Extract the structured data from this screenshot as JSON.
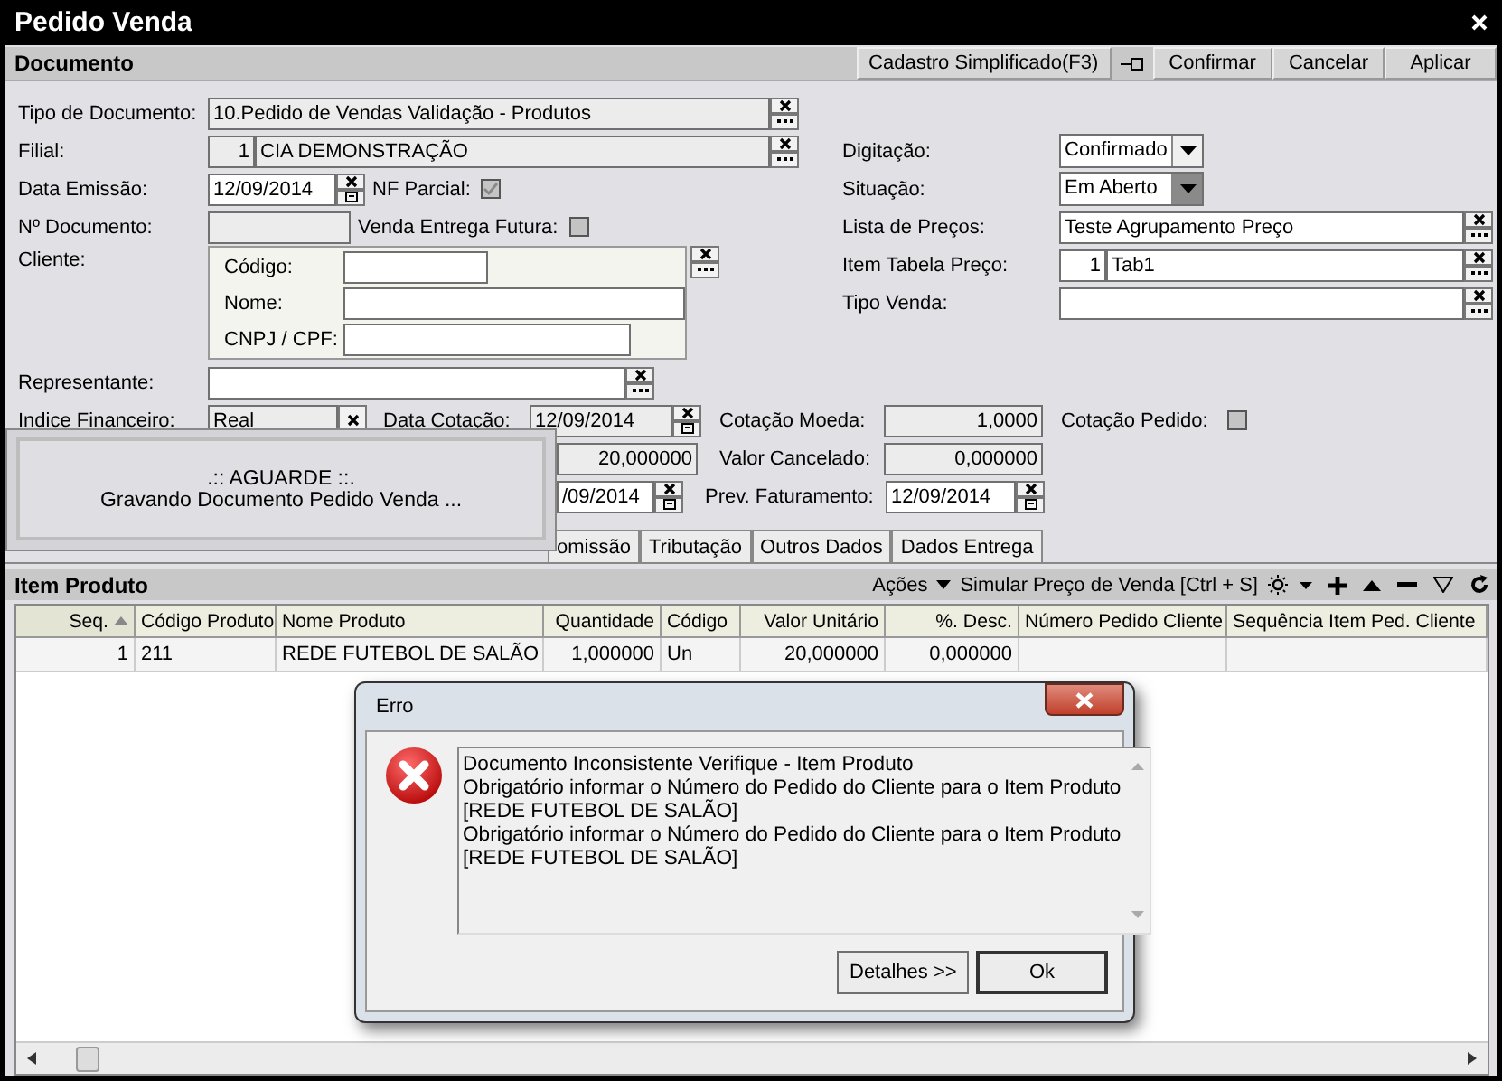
{
  "window": {
    "title": "Pedido Venda"
  },
  "header": {
    "title": "Documento",
    "buttons": [
      {
        "kind": "text",
        "label": "Cadastro Simplificado(F3)"
      },
      {
        "kind": "pin"
      },
      {
        "kind": "text",
        "label": "Confirmar"
      },
      {
        "kind": "text",
        "label": "Cancelar"
      },
      {
        "kind": "text",
        "label": "Aplicar"
      }
    ]
  },
  "left_fields": [
    {
      "kind": "lookup",
      "label": "Tipo de Documento:",
      "value": "10.Pedido de Vendas Validação - Produtos",
      "readonly": true
    },
    {
      "kind": "code_lookup",
      "label": "Filial:",
      "code": "1",
      "value": "CIA DEMONSTRAÇÃO",
      "readonly": true
    },
    {
      "kind": "date",
      "label": "Data Emissão:",
      "value": "12/09/2014",
      "check": {
        "label": "NF Parcial:",
        "checked": true,
        "disabled": true
      }
    },
    {
      "kind": "text",
      "label": "Nº Documento:",
      "readonly": true,
      "check": {
        "label": "Venda Entrega Futura:",
        "checked": false,
        "disabled": true
      }
    },
    {
      "kind": "client",
      "label": "Cliente:",
      "fields": [
        {
          "label": "Código:"
        },
        {
          "label": "Nome:"
        },
        {
          "label": "CNPJ / CPF:"
        }
      ]
    },
    {
      "kind": "lookup",
      "label": "Representante:",
      "readonly": false
    }
  ],
  "right_fields": [
    {
      "kind": "dropdown",
      "label": "Digitação:",
      "value": "Confirmado",
      "disabled": false
    },
    {
      "kind": "dropdown",
      "label": "Situação:",
      "value": "Em Aberto",
      "disabled": true
    },
    {
      "kind": "lookup",
      "label": "Lista de Preços:",
      "value": "Teste Agrupamento Preço",
      "readonly": false
    },
    {
      "kind": "code_lookup",
      "label": "Item Tabela Preço:",
      "code": "1",
      "value": "Tab1",
      "readonly": false
    },
    {
      "kind": "lookup",
      "label": "Tipo Venda:",
      "readonly": false
    }
  ],
  "values": {
    "indice": {
      "label": "Indice Financeiro:",
      "value": "Real",
      "readonly": true
    },
    "data_cotacao": {
      "label": "Data Cotação:",
      "value": "12/09/2014",
      "readonly": true
    },
    "cotacao_moeda": {
      "label": "Cotação Moeda:",
      "value": "1,0000",
      "readonly": true
    },
    "cotacao_pedido": {
      "label": "Cotação Pedido:",
      "checked": false,
      "disabled": true
    },
    "valor": {
      "value": "20,000000",
      "readonly": true
    },
    "valor_cancelado": {
      "label": "Valor Cancelado:",
      "value": "0,000000",
      "readonly": true
    },
    "data": {
      "value": "/09/2014",
      "readonly": false
    },
    "prev_faturamento": {
      "label": "Prev. Faturamento:",
      "value": "12/09/2014",
      "readonly": false
    }
  },
  "tabs": [
    {
      "label": "omissão",
      "selected": false
    },
    {
      "label": "Tributação",
      "selected": false
    },
    {
      "label": "Outros Dados",
      "selected": false
    },
    {
      "label": "Dados Entrega",
      "selected": false
    }
  ],
  "items_panel": {
    "title": "Item Produto",
    "actions": "Ações",
    "simulate": "Simular Preço de Venda [Ctrl + S]"
  },
  "table": {
    "columns": [
      {
        "label": "Seq.",
        "sorted": true
      },
      {
        "label": "Código Produto",
        "sorted": false
      },
      {
        "label": "Nome Produto",
        "sorted": false
      },
      {
        "label": "Quantidade",
        "sorted": false
      },
      {
        "label": "Código",
        "sorted": false
      },
      {
        "label": "Valor Unitário",
        "sorted": false
      },
      {
        "label": "%. Desc.",
        "sorted": false
      },
      {
        "label": "Número Pedido Cliente",
        "sorted": false
      },
      {
        "label": "Sequência Item Ped. Cliente",
        "sorted": false
      }
    ],
    "rows": [
      [
        "1",
        "211",
        "REDE FUTEBOL DE SALÃO",
        "1,000000",
        "Un",
        "20,000000",
        "0,000000"
      ]
    ]
  },
  "overlay": {
    "lines": [
      ".:: AGUARDE ::.",
      "Gravando Documento Pedido Venda ..."
    ]
  },
  "dialog": {
    "title": "Erro",
    "message": [
      "Documento Inconsistente Verifique - Item Produto",
      "Obrigatório informar o Número do Pedido do Cliente para o Item Produto",
      "[REDE FUTEBOL DE SALÃO]",
      "Obrigatório informar o Número do Pedido do Cliente para o Item Produto",
      "[REDE FUTEBOL DE SALÃO]"
    ],
    "buttons": [
      {
        "label": "Detalhes >>",
        "default": false
      },
      {
        "label": "Ok",
        "default": true
      }
    ]
  }
}
